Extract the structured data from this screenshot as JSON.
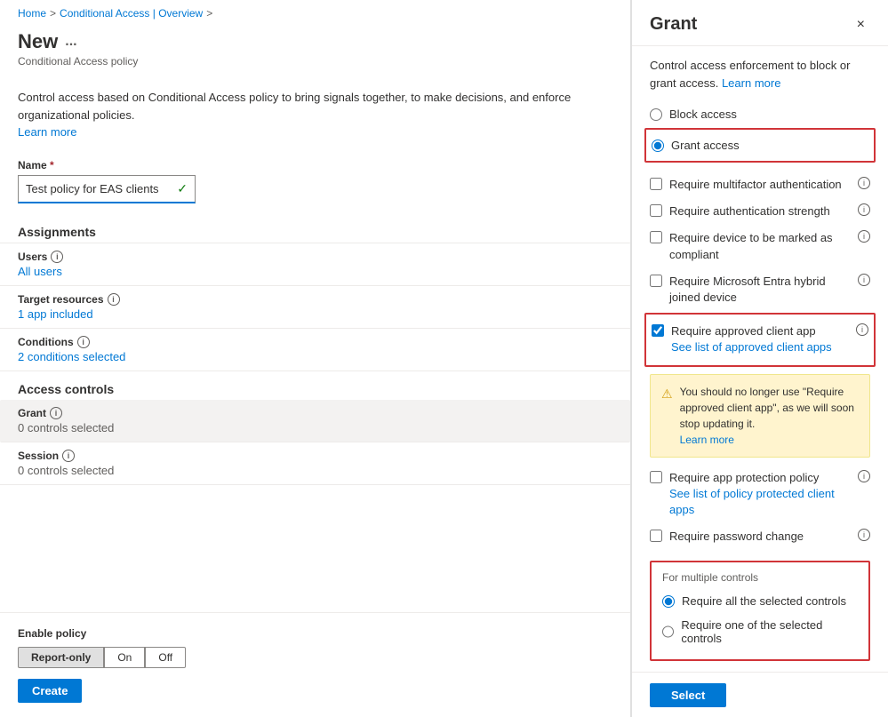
{
  "breadcrumb": {
    "home": "Home",
    "separator1": ">",
    "conditional_access": "Conditional Access | Overview",
    "separator2": ">"
  },
  "page": {
    "title": "New",
    "subtitle": "Conditional Access policy",
    "description": "Control access based on Conditional Access policy to bring signals together, to make decisions, and enforce organizational policies.",
    "learn_more": "Learn more"
  },
  "form": {
    "name_label": "Name",
    "name_required": "*",
    "name_value": "Test policy for EAS clients",
    "name_checkmark": "✓"
  },
  "assignments": {
    "title": "Assignments",
    "users_label": "Users",
    "users_value": "All users",
    "target_resources_label": "Target resources",
    "target_resources_value": "1 app included",
    "conditions_label": "Conditions",
    "conditions_value": "2 conditions selected"
  },
  "access_controls": {
    "title": "Access controls",
    "grant_label": "Grant",
    "grant_value": "0 controls selected",
    "session_label": "Session",
    "session_value": "0 controls selected"
  },
  "enable_policy": {
    "label": "Enable policy",
    "report_only": "Report-only",
    "on": "On",
    "off": "Off",
    "create_btn": "Create"
  },
  "grant_panel": {
    "title": "Grant",
    "close": "×",
    "description": "Control access enforcement to block or grant access.",
    "learn_more": "Learn more",
    "block_access_label": "Block access",
    "grant_access_label": "Grant access",
    "checkboxes": [
      {
        "id": "mfa",
        "label": "Require multifactor authentication",
        "checked": false,
        "has_info": true
      },
      {
        "id": "auth_strength",
        "label": "Require authentication strength",
        "checked": false,
        "has_info": true
      },
      {
        "id": "compliant",
        "label": "Require device to be marked as compliant",
        "checked": false,
        "has_info": true
      },
      {
        "id": "hybrid",
        "label": "Require Microsoft Entra hybrid joined device",
        "checked": false,
        "has_info": true
      },
      {
        "id": "approved_client",
        "label": "Require approved client app",
        "checked": true,
        "has_info": true,
        "sublabel": "See list of approved client apps",
        "highlighted": true
      },
      {
        "id": "app_protection",
        "label": "Require app protection policy",
        "checked": false,
        "has_info": true,
        "sublabel": "See list of policy protected client apps"
      },
      {
        "id": "password_change",
        "label": "Require password change",
        "checked": false,
        "has_info": true
      }
    ],
    "warning": {
      "text": "You should no longer use \"Require approved client app\", as we will soon stop updating it.",
      "learn_more": "Learn more"
    },
    "multiple_controls": {
      "label": "For multiple controls",
      "option1": "Require all the selected controls",
      "option2": "Require one of the selected controls",
      "selected": "option1"
    },
    "select_btn": "Select"
  }
}
